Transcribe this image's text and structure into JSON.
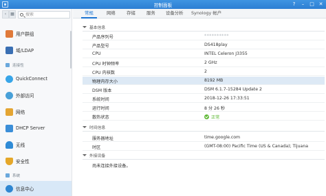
{
  "window": {
    "title": "控制面板",
    "buttons": [
      "?",
      "–",
      "□",
      "✕"
    ]
  },
  "search": {
    "placeholder": "搜索"
  },
  "sidebar": {
    "items": [
      {
        "label": "用户群组",
        "icon": "users-icon",
        "color": "#e07a3a"
      },
      {
        "label": "域/LDAP",
        "icon": "domain-icon",
        "color": "#3a6fb3"
      },
      {
        "label": "QuickConnect",
        "icon": "quickconnect-icon",
        "color": "#38a5e8"
      },
      {
        "label": "外部访问",
        "icon": "globe-icon",
        "color": "#48a0d8"
      },
      {
        "label": "网络",
        "icon": "network-icon",
        "color": "#e4a533"
      },
      {
        "label": "DHCP Server",
        "icon": "dhcp-icon",
        "color": "#3b8ed8"
      },
      {
        "label": "无线",
        "icon": "wifi-icon",
        "color": "#2f8bd6"
      },
      {
        "label": "安全性",
        "icon": "shield-icon",
        "color": "#e5a729"
      },
      {
        "label": "信息中心",
        "icon": "info-icon",
        "color": "#2f86d1"
      }
    ],
    "sections": {
      "connectivity": "连接性",
      "system": "系统"
    }
  },
  "tabs": [
    "常规",
    "网络",
    "存储",
    "服务",
    "设备分析",
    "Synology 帐户"
  ],
  "groups": {
    "basic": "基本信息",
    "time": "时间信息",
    "external": "外接设备"
  },
  "basic_rows": [
    {
      "key": "产品序列号",
      "value": "**********"
    },
    {
      "key": "产品型号",
      "value": "DS418play"
    },
    {
      "key": "CPU",
      "value": "INTEL Celeron J3355"
    },
    {
      "key": "CPU 时钟频率",
      "value": "2 GHz"
    },
    {
      "key": "CPU 内核数",
      "value": "2"
    },
    {
      "key": "物理内存大小",
      "value": "8192 MB"
    },
    {
      "key": "DSM 版本",
      "value": "DSM 6.1.7-15284 Update 2"
    },
    {
      "key": "系统时间",
      "value": "2018-12-26 17:33:51"
    },
    {
      "key": "运行时间",
      "value": "8 分 26 秒"
    },
    {
      "key": "散热状态",
      "value": "正常"
    }
  ],
  "time_rows": [
    {
      "key": "服务器地址",
      "value": "time.google.com"
    },
    {
      "key": "时区",
      "value": "(GMT-08:00) Pacific Time (US & Canada); Tijuana"
    }
  ],
  "external_rows": [
    {
      "key": "尚未连接外接设备。",
      "value": ""
    }
  ],
  "colors": {
    "accent": "#1a73d1",
    "titlebar": "#2d7fd3",
    "ok": "#5fb936",
    "selected_row": "#dde9f5"
  }
}
